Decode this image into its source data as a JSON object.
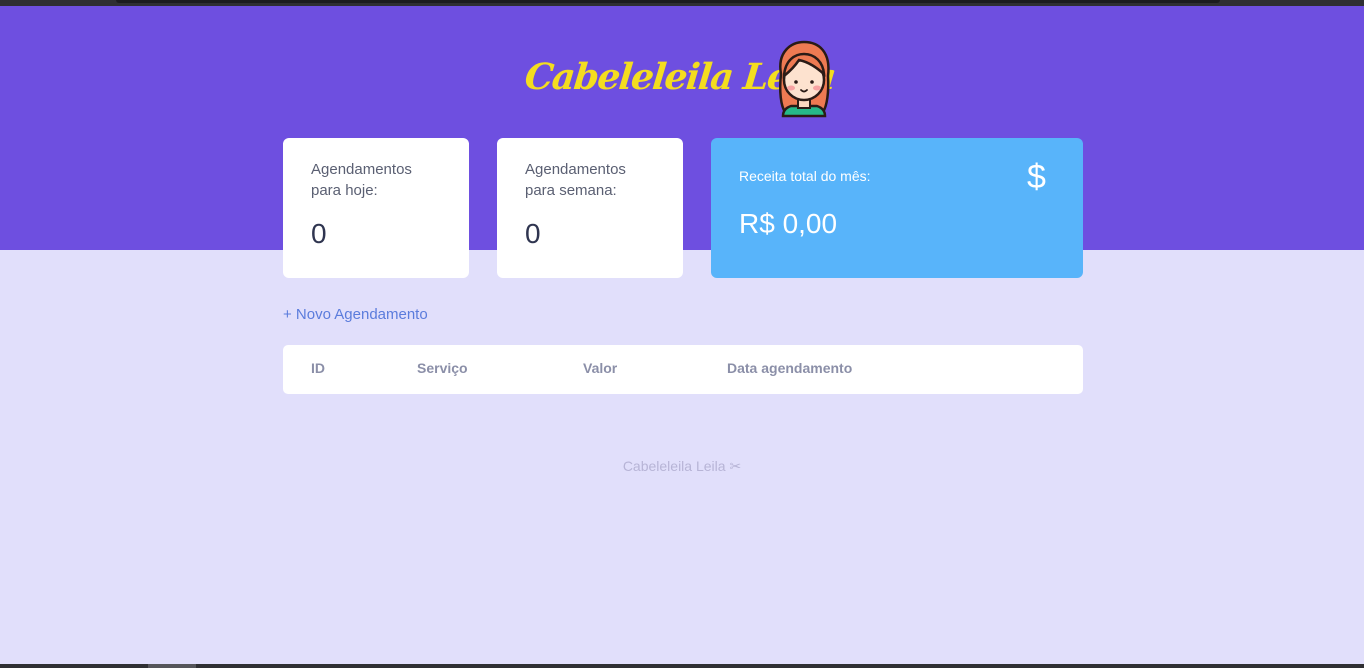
{
  "brand": {
    "title": "Cabeleleila Leila",
    "logo_icon": "girl-avatar-icon"
  },
  "cards": {
    "today": {
      "label": "Agendamentos para hoje:",
      "value": "0"
    },
    "week": {
      "label": "Agendamentos para semana:",
      "value": "0"
    },
    "revenue": {
      "label": "Receita total do mês:",
      "value": "R$ 0,00",
      "icon": "$"
    }
  },
  "actions": {
    "new_appointment": "+ Novo Agendamento"
  },
  "table": {
    "columns": [
      "ID",
      "Serviço",
      "Valor",
      "Data agendamento"
    ],
    "rows": []
  },
  "footer": {
    "text": "Cabeleleila Leila ✂"
  },
  "colors": {
    "hero_bg": "#6e4fe0",
    "page_bg": "#e1dffb",
    "brand_yellow": "#f4dd1f",
    "revenue_card": "#58b4fa",
    "link": "#5b7cdc"
  }
}
